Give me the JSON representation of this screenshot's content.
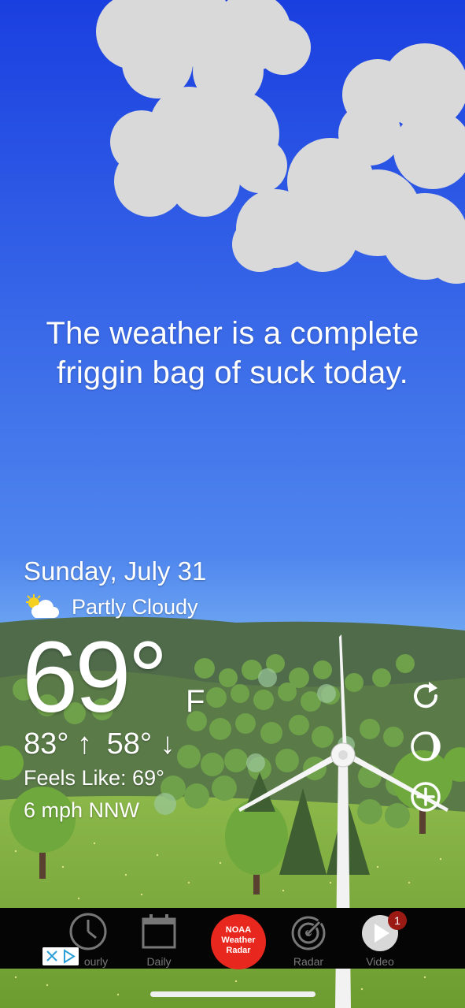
{
  "headline": {
    "line1": "The weather is a complete",
    "line2": "friggin bag of suck today."
  },
  "current": {
    "date": "Sunday, July 31",
    "condition": "Partly Cloudy",
    "condition_icon": "partly-cloudy-icon",
    "temperature": "69°",
    "unit": "F",
    "high": "83° ↑",
    "low": "58° ↓",
    "feels_like": "Feels Like: 69°",
    "wind": "6 mph NNW"
  },
  "controls": [
    {
      "icon": "refresh-icon"
    },
    {
      "icon": "moon-phase-icon"
    },
    {
      "icon": "add-icon"
    }
  ],
  "tabs": {
    "hourly": "ourly",
    "daily": "Daily",
    "noaa": "NOAA\nWeather\nRadar",
    "radar": "Radar",
    "video": "Video",
    "video_badge": "1"
  },
  "colors": {
    "sky_top": "#1a3fe0",
    "sky_bottom": "#7ab0f2",
    "hills": "#4f6b4a",
    "grass": "#7aa83c",
    "noaa_red": "#e8281e",
    "tabbar": "#050505"
  }
}
